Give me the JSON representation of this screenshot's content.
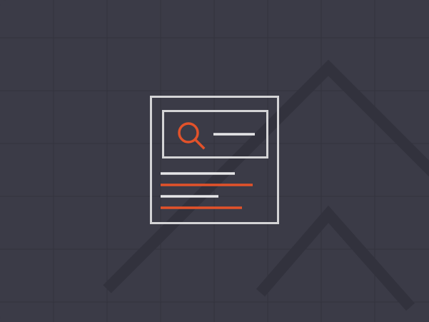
{
  "colors": {
    "background": "#3b3b47",
    "grid": "#34343f",
    "chevron": "#34343f",
    "frame": "#d4d4d6",
    "accent": "#e2522a",
    "light_line": "#e6e6e8"
  },
  "illustration": {
    "icon": "search-document-icon",
    "search_icon": "magnifier-icon",
    "search_bar_text_lines": 1,
    "content_lines": [
      {
        "tone": "light"
      },
      {
        "tone": "accent"
      },
      {
        "tone": "light"
      },
      {
        "tone": "accent"
      }
    ]
  }
}
